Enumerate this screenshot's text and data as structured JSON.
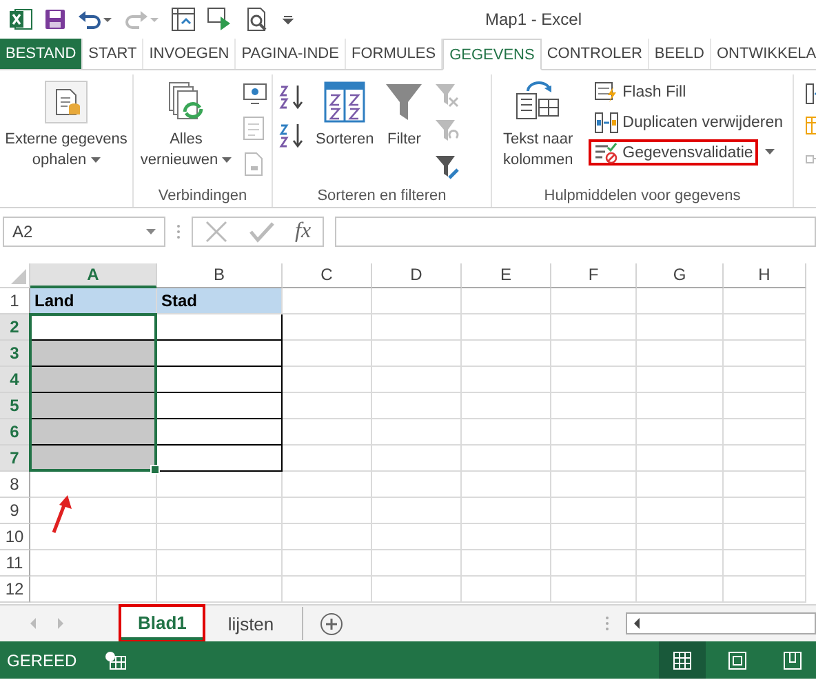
{
  "window": {
    "title": "Map1 - Excel"
  },
  "tabs": [
    {
      "label": "BESTAND",
      "kind": "file",
      "selected": false
    },
    {
      "label": "START",
      "kind": "tab",
      "selected": false
    },
    {
      "label": "INVOEGEN",
      "kind": "tab",
      "selected": false
    },
    {
      "label": "PAGINA-INDE",
      "kind": "tab",
      "selected": false
    },
    {
      "label": "FORMULES",
      "kind": "tab",
      "selected": false
    },
    {
      "label": "GEGEVENS",
      "kind": "tab",
      "selected": true
    },
    {
      "label": "CONTROLER",
      "kind": "tab",
      "selected": false
    },
    {
      "label": "BEELD",
      "kind": "tab",
      "selected": false
    },
    {
      "label": "ONTWIKKELA",
      "kind": "tab",
      "selected": false
    }
  ],
  "ribbon": {
    "groups": [
      {
        "commands": [
          {
            "label": "Externe gegevens ophalen",
            "dropdown": true,
            "highlighted": false
          }
        ]
      },
      {
        "label": "Verbindingen",
        "commands": [
          {
            "label": "Alles vernieuwen",
            "dropdown": true,
            "highlighted": false
          }
        ]
      },
      {
        "label": "Sorteren en filteren",
        "commands": [
          {
            "label": "Sorteren",
            "dropdown": false,
            "highlighted": false
          },
          {
            "label": "Filter",
            "dropdown": false,
            "highlighted": false
          }
        ]
      },
      {
        "label": "Hulpmiddelen voor gegevens",
        "commands": [
          {
            "label": "Tekst naar kolommen",
            "dropdown": false,
            "highlighted": false
          },
          {
            "label": "Flash Fill",
            "dropdown": false,
            "highlighted": false
          },
          {
            "label": "Duplicaten verwijderen",
            "dropdown": false,
            "highlighted": false
          },
          {
            "label": "Gegevensvalidatie",
            "dropdown": true,
            "highlighted": true
          }
        ]
      }
    ]
  },
  "formula_bar": {
    "name_box": "A2",
    "function_button": "fx"
  },
  "columns": [
    {
      "label": "A",
      "selected": true
    },
    {
      "label": "B",
      "selected": false
    },
    {
      "label": "C",
      "selected": false
    },
    {
      "label": "D",
      "selected": false
    },
    {
      "label": "E",
      "selected": false
    },
    {
      "label": "F",
      "selected": false
    },
    {
      "label": "G",
      "selected": false
    },
    {
      "label": "H",
      "selected": false
    }
  ],
  "rows": [
    {
      "label": "1",
      "selected": false,
      "cells": [
        {
          "value": "Land",
          "kind": "header"
        },
        {
          "value": "Stad",
          "kind": "header"
        }
      ]
    },
    {
      "label": "2",
      "selected": true,
      "cells": [
        {
          "kind": "bordered"
        },
        {
          "kind": "bordered"
        }
      ]
    },
    {
      "label": "3",
      "selected": true,
      "cells": [
        {
          "kind": "shaded"
        },
        {
          "kind": "bordered"
        }
      ]
    },
    {
      "label": "4",
      "selected": true,
      "cells": [
        {
          "kind": "shaded"
        },
        {
          "kind": "bordered"
        }
      ]
    },
    {
      "label": "5",
      "selected": true,
      "cells": [
        {
          "kind": "shaded"
        },
        {
          "kind": "bordered"
        }
      ]
    },
    {
      "label": "6",
      "selected": true,
      "cells": [
        {
          "kind": "shaded"
        },
        {
          "kind": "bordered"
        }
      ]
    },
    {
      "label": "7",
      "selected": true,
      "cells": [
        {
          "kind": "shaded"
        },
        {
          "kind": "bordered"
        }
      ]
    },
    {
      "label": "8",
      "selected": false
    },
    {
      "label": "9",
      "selected": false
    },
    {
      "label": "10",
      "selected": false
    },
    {
      "label": "11",
      "selected": false
    },
    {
      "label": "12",
      "selected": false
    }
  ],
  "sheets": [
    {
      "label": "Blad1",
      "selected": true,
      "highlighted": true
    },
    {
      "label": "lijsten",
      "selected": false,
      "highlighted": false
    }
  ],
  "status_bar": {
    "status": "GEREED"
  }
}
